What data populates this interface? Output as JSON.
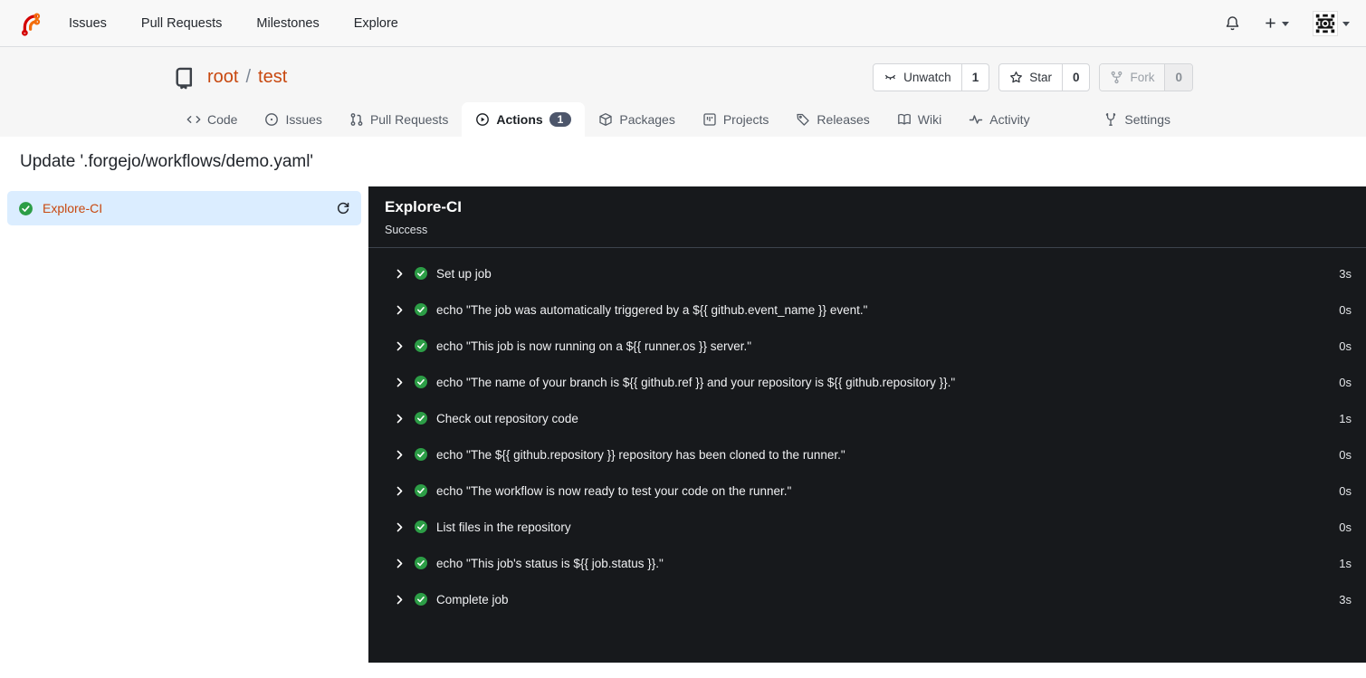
{
  "colors": {
    "accent_orange": "#c8480f",
    "success_green": "#2c9d46",
    "panel_bg": "#17191c",
    "selected_job_bg": "#dbedff",
    "badge_bg": "#4d566b"
  },
  "navbar": {
    "links": [
      "Issues",
      "Pull Requests",
      "Milestones",
      "Explore"
    ],
    "icons": [
      "forgejo-logo",
      "bell-icon",
      "plus-icon",
      "avatar-identicon"
    ]
  },
  "repo": {
    "owner": "root",
    "separator": "/",
    "name": "test",
    "buttons": [
      {
        "label": "Unwatch",
        "count": "1"
      },
      {
        "label": "Star",
        "count": "0"
      },
      {
        "label": "Fork",
        "count": "0"
      }
    ],
    "tabs": [
      {
        "label": "Code"
      },
      {
        "label": "Issues"
      },
      {
        "label": "Pull Requests"
      },
      {
        "label": "Actions",
        "badge": "1"
      },
      {
        "label": "Packages"
      },
      {
        "label": "Projects"
      },
      {
        "label": "Releases"
      },
      {
        "label": "Wiki"
      },
      {
        "label": "Activity"
      },
      {
        "label": "Settings"
      }
    ]
  },
  "run": {
    "title": "Update '.forgejo/workflows/demo.yaml'",
    "job": {
      "name": "Explore-CI",
      "status": "success"
    }
  },
  "panel": {
    "job_name": "Explore-CI",
    "status": "Success",
    "steps": [
      {
        "label": "Set up job",
        "duration": "3s"
      },
      {
        "label": "echo \"The job was automatically triggered by a ${{ github.event_name }} event.\"",
        "duration": "0s"
      },
      {
        "label": "echo \"This job is now running on a ${{ runner.os }} server.\"",
        "duration": "0s"
      },
      {
        "label": "echo \"The name of your branch is ${{ github.ref }} and your repository is ${{ github.repository }}.\"",
        "duration": "0s"
      },
      {
        "label": "Check out repository code",
        "duration": "1s"
      },
      {
        "label": "echo \"The ${{ github.repository }} repository has been cloned to the runner.\"",
        "duration": "0s"
      },
      {
        "label": "echo \"The workflow is now ready to test your code on the runner.\"",
        "duration": "0s"
      },
      {
        "label": "List files in the repository",
        "duration": "0s"
      },
      {
        "label": "echo \"This job's status is ${{ job.status }}.\"",
        "duration": "1s"
      },
      {
        "label": "Complete job",
        "duration": "3s"
      }
    ]
  }
}
